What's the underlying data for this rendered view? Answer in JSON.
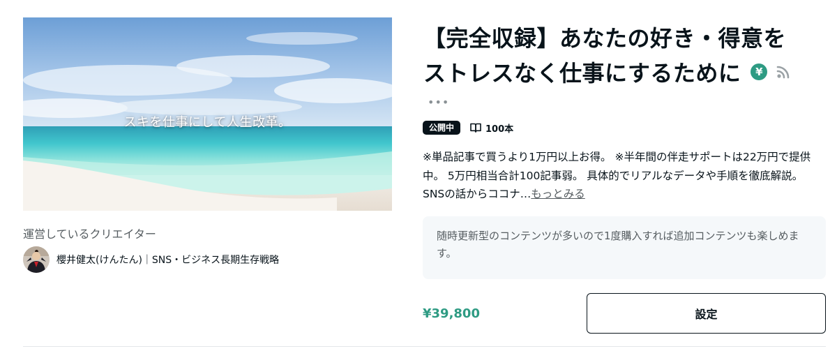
{
  "hero": {
    "caption": "スキを仕事にして人生改革。"
  },
  "creator": {
    "heading": "運営しているクリエイター",
    "name": "櫻井健太(けんたん)｜SNS・ビジネス長期生存戦略"
  },
  "magazine": {
    "title_line1": "【完全収録】あなたの好き・得意を",
    "title_line2": "ストレスなく仕事にするために",
    "yen_symbol": "¥",
    "more_dots": "•••",
    "status": "公開中",
    "article_count": "100本",
    "description": "※単品記事で買うより1万円以上お得。 ※半年間の伴走サポートは22万円で提供中。 5万円相当合計100記事弱。 具体的でリアルなデータや手順を徹底解説。 SNSの話からココナ…",
    "more_link": "もっとみる",
    "notice": "随時更新型のコンテンツが多いので1度購入すれば追加コンテンツも楽しめます。",
    "price": "¥39,800",
    "settings_label": "設定"
  },
  "icons": {
    "yen_badge": "yen-icon",
    "rss": "rss-icon",
    "book": "book-icon",
    "more": "more-dots-icon"
  },
  "colors": {
    "accent_green": "#2e9b83",
    "text_primary": "#08131a",
    "text_secondary": "#555c60",
    "notice_bg": "#f5f8fa"
  }
}
